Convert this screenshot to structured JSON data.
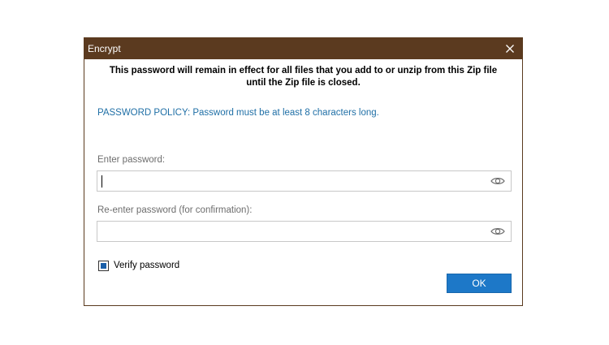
{
  "dialog": {
    "title": "Encrypt",
    "close_icon": "close-icon",
    "message_line1": "This password will remain in effect for all files that you add to or unzip from this Zip file",
    "message_line2": "until the Zip file is closed.",
    "policy": "PASSWORD POLICY: Password must be at least 8 characters long.",
    "password_label": "Enter password:",
    "password_value": "",
    "confirm_label": "Re-enter password (for confirmation):",
    "confirm_value": "",
    "show_password_icon": "eye-icon",
    "verify_label": "Verify password",
    "verify_checked": true,
    "ok_label": "OK"
  },
  "colors": {
    "titlebar": "#5b3a1f",
    "policy_text": "#1f6fa6",
    "ok_button": "#1d78c8",
    "checkbox_fill": "#1a5fa8"
  }
}
